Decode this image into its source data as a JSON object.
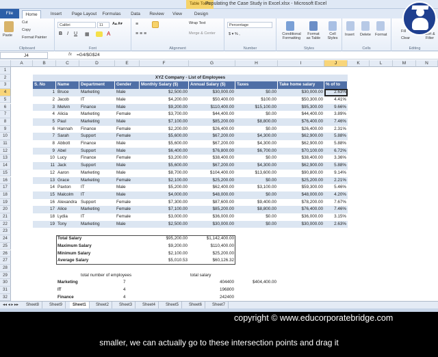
{
  "window": {
    "title": "Populating the Case Study in Excel.xlsx - Microsoft Excel",
    "context_tab": "Table Tools"
  },
  "ribbon_tabs": [
    "File",
    "Home",
    "Insert",
    "Page Layout",
    "Formulas",
    "Data",
    "Review",
    "View",
    "Design"
  ],
  "ribbon": {
    "clipboard": {
      "paste": "Paste",
      "cut": "Cut",
      "copy": "Copy",
      "format_painter": "Format Painter",
      "label": "Clipboard"
    },
    "font": {
      "name": "Calibri",
      "size": "11",
      "label": "Font"
    },
    "alignment": {
      "wrap": "Wrap Text",
      "merge": "Merge & Center",
      "label": "Alignment"
    },
    "number": {
      "format": "Percentage",
      "label": "Number"
    },
    "styles": {
      "conditional": "Conditional Formatting",
      "format_table": "Format as Table",
      "cell_styles": "Cell Styles",
      "label": "Styles"
    },
    "cells": {
      "insert": "Insert",
      "delete": "Delete",
      "format": "Format",
      "label": "Cells"
    },
    "editing": {
      "fill": "Fill",
      "clear": "Clear",
      "sort": "Sort & Filter",
      "label": "Editing"
    }
  },
  "formula_bar": {
    "name_box": "J4",
    "fx": "fx",
    "formula": "=G4/$G$24"
  },
  "columns": [
    "A",
    "B",
    "C",
    "D",
    "E",
    "F",
    "G",
    "H",
    "I",
    "J",
    "K",
    "L",
    "M",
    "N"
  ],
  "rows": [
    "1",
    "2",
    "3",
    "4",
    "5",
    "6",
    "7",
    "8",
    "9",
    "10",
    "11",
    "12",
    "13",
    "14",
    "15",
    "16",
    "17",
    "18",
    "19",
    "20",
    "21",
    "22",
    "23",
    "24",
    "25",
    "26",
    "27",
    "28",
    "29",
    "30",
    "31",
    "32"
  ],
  "table": {
    "title": "XYZ Company - List of Employees",
    "headers": [
      "S. No",
      "Name",
      "Department",
      "Gender",
      "Monthly Salary ($)",
      "Annual Salary ($)",
      "Taxes",
      "Take home salary",
      "% of to"
    ],
    "rows": [
      [
        "1",
        "Bruce",
        "Marketing",
        "Male",
        "$2,500.00",
        "$30,000.00",
        "$0.00",
        "$30,000.00",
        "2.63%"
      ],
      [
        "2",
        "Jacob",
        "IT",
        "Male",
        "$4,200.00",
        "$50,400.00",
        "$100.00",
        "$50,300.00",
        "4.41%"
      ],
      [
        "3",
        "Melvin",
        "Finance",
        "Male",
        "$9,200.00",
        "$110,400.00",
        "$15,100.00",
        "$95,300.00",
        "9.66%"
      ],
      [
        "4",
        "Alicia",
        "Marketing",
        "Female",
        "$3,700.00",
        "$44,400.00",
        "$0.00",
        "$44,400.00",
        "3.89%"
      ],
      [
        "5",
        "Paul",
        "Marketing",
        "Male",
        "$7,100.00",
        "$85,200.00",
        "$8,800.00",
        "$76,400.00",
        "7.46%"
      ],
      [
        "6",
        "Hannah",
        "Finance",
        "Female",
        "$2,200.00",
        "$26,400.00",
        "$0.00",
        "$26,400.00",
        "2.31%"
      ],
      [
        "7",
        "Sarah",
        "Support",
        "Female",
        "$5,600.00",
        "$67,200.00",
        "$4,300.00",
        "$62,900.00",
        "5.88%"
      ],
      [
        "8",
        "Abbott",
        "Finance",
        "Male",
        "$5,600.00",
        "$67,200.00",
        "$4,300.00",
        "$62,900.00",
        "5.88%"
      ],
      [
        "9",
        "Abel",
        "Support",
        "Male",
        "$6,400.00",
        "$76,800.00",
        "$6,700.00",
        "$70,100.00",
        "6.72%"
      ],
      [
        "10",
        "Lucy",
        "Finance",
        "Female",
        "$3,200.00",
        "$38,400.00",
        "$0.00",
        "$38,400.00",
        "3.36%"
      ],
      [
        "11",
        "Jack",
        "Support",
        "Male",
        "$5,600.00",
        "$67,200.00",
        "$4,300.00",
        "$62,900.00",
        "5.88%"
      ],
      [
        "12",
        "Aaron",
        "Marketing",
        "Male",
        "$8,700.00",
        "$104,400.00",
        "$13,600.00",
        "$90,800.00",
        "9.14%"
      ],
      [
        "13",
        "Grace",
        "Marketing",
        "Female",
        "$2,100.00",
        "$25,200.00",
        "$0.00",
        "$25,200.00",
        "2.21%"
      ],
      [
        "14",
        "Paxton",
        "IT",
        "Male",
        "$5,200.00",
        "$62,400.00",
        "$3,100.00",
        "$59,300.00",
        "5.46%"
      ],
      [
        "15",
        "Malcolm",
        "IT",
        "Male",
        "$4,000.00",
        "$48,000.00",
        "$0.00",
        "$48,000.00",
        "4.20%"
      ],
      [
        "16",
        "Alexandra",
        "Support",
        "Female",
        "$7,300.00",
        "$87,600.00",
        "$9,400.00",
        "$78,200.00",
        "7.67%"
      ],
      [
        "17",
        "Alice",
        "Marketing",
        "Female",
        "$7,100.00",
        "$85,200.00",
        "$8,800.00",
        "$76,400.00",
        "7.46%"
      ],
      [
        "18",
        "Lydia",
        "IT",
        "Female",
        "$3,000.00",
        "$36,000.00",
        "$0.00",
        "$36,000.00",
        "3.15%"
      ],
      [
        "19",
        "Tony",
        "Marketing",
        "Male",
        "$2,500.00",
        "$30,000.00",
        "$0.00",
        "$30,000.00",
        "2.63%"
      ]
    ]
  },
  "summary": [
    [
      "Total Salary",
      "$95,200.00",
      "$1,142,400.00"
    ],
    [
      "Maximum Salary",
      "$9,200.00",
      "$110,400.00"
    ],
    [
      "Minimum Salary",
      "$2,100.00",
      "$25,200.00"
    ],
    [
      "Average Salary",
      "$5,010.53",
      "$60,126.32"
    ]
  ],
  "dept_summary": {
    "count_label": "total number of employees",
    "salary_label": "total salary",
    "rows": [
      [
        "Marketing",
        "7",
        "404400",
        "$404,400.00"
      ],
      [
        "IT",
        "4",
        "196800",
        ""
      ],
      [
        "Finance",
        "4",
        "242400",
        ""
      ]
    ]
  },
  "sheets": [
    "Sheet8",
    "Sheet9",
    "Sheet1",
    "Sheet2",
    "Sheet3",
    "Sheet4",
    "Sheet5",
    "Sheet6",
    "Sheet7"
  ],
  "active_sheet": "Sheet1",
  "copyright": "copyright © www.educorporatebridge.com",
  "subtitle": "smaller, we can actually go to these intersection points and drag it"
}
